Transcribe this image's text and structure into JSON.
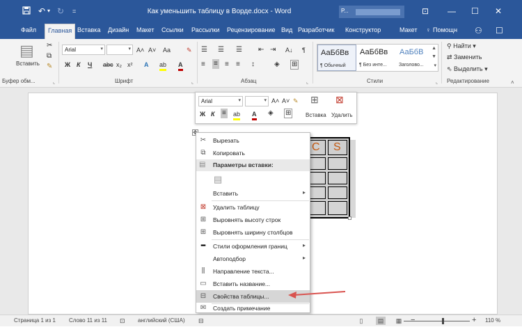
{
  "titlebar": {
    "title": "Как уменьшить таблицу в Ворде.docx - Word",
    "account_initial": "Р...",
    "undo_caret": "▾",
    "customize_caret": "=",
    "display_options": "⊡",
    "minimize": "—",
    "maximize": "☐",
    "close": "✕"
  },
  "tabs": [
    {
      "label": "Файл"
    },
    {
      "label": "Главная"
    },
    {
      "label": "Вставка"
    },
    {
      "label": "Дизайн"
    },
    {
      "label": "Макет"
    },
    {
      "label": "Ссылки"
    },
    {
      "label": "Рассылки"
    },
    {
      "label": "Рецензирование"
    },
    {
      "label": "Вид"
    },
    {
      "label": "Разработчик"
    },
    {
      "label": "Конструктор"
    },
    {
      "label": "Макет"
    }
  ],
  "help": "Помощн",
  "ribbon": {
    "clipboard": {
      "label": "Буфер обм...",
      "paste": "Вставить"
    },
    "font": {
      "label": "Шрифт",
      "name": "Arial",
      "size": "",
      "grow": "A˄",
      "shrink": "A˅",
      "case": "Aa",
      "clear": "✎",
      "bold": "Ж",
      "italic": "К",
      "underline": "Ч",
      "strike": "abc",
      "sub": "x₂",
      "sup": "x²",
      "effects": "A",
      "highlight": "ab",
      "color": "A"
    },
    "paragraph": {
      "label": "Абзац",
      "sort": "A↓",
      "marks": "¶"
    },
    "styles": {
      "label": "Стили",
      "items": [
        {
          "sample": "АаБбВв",
          "name": "¶ Обычный"
        },
        {
          "sample": "АаБбВв",
          "name": "¶ Без инте..."
        },
        {
          "sample": "АаБбВ",
          "name": "Заголово..."
        }
      ]
    },
    "editing": {
      "label": "Редактирование",
      "find": "Найти",
      "replace": "Заменить",
      "select": "Выделить"
    }
  },
  "mini_toolbar": {
    "font": "Arial",
    "size": "",
    "grow": "A˄",
    "shrink": "A˅",
    "painter": "✎",
    "bold": "Ж",
    "italic": "К",
    "highlight": "ab",
    "color": "A",
    "insert": "Вставка",
    "delete": "Удалить"
  },
  "table": {
    "cells": [
      "C",
      "S"
    ]
  },
  "context_menu": {
    "cut": "Вырезать",
    "copy": "Копировать",
    "paste_header": "Параметры вставки:",
    "insert": "Вставить",
    "delete_table": "Удалить таблицу",
    "distribute_rows": "Выровнять высоту строк",
    "distribute_cols": "Выровнять ширину столбцов",
    "border_styles": "Стили оформления границ",
    "autofit": "Автоподбор",
    "text_direction": "Направление текста...",
    "insert_caption": "Вставить название...",
    "table_properties": "Свойства таблицы...",
    "new_comment": "Создать примечание"
  },
  "statusbar": {
    "page": "Страница 1 из 1",
    "words": "Слово 11 из 11",
    "language": "английский (США)",
    "zoom": "110 %",
    "zoom_level": 0.585
  },
  "colors": {
    "word_blue": "#2b579a",
    "ribbon_bg": "#f3f3f3",
    "arrow": "#d9534f",
    "cell_letters": "#c55a11"
  }
}
